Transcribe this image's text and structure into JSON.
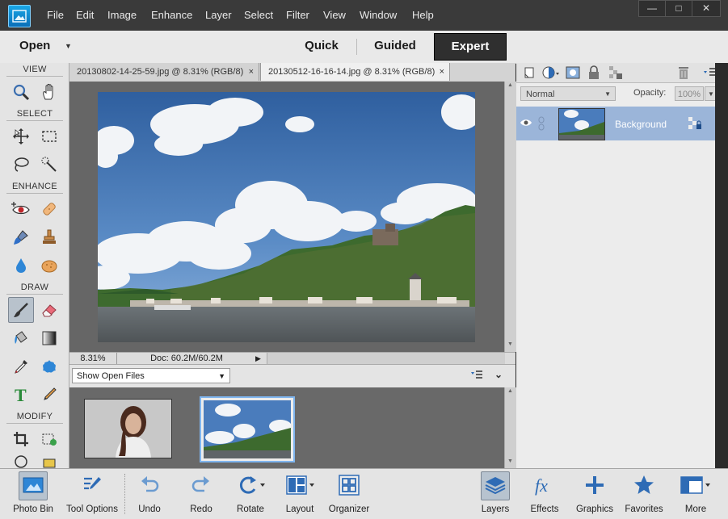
{
  "menubar": {
    "items": [
      "File",
      "Edit",
      "Image",
      "Enhance",
      "Layer",
      "Select",
      "Filter",
      "View",
      "Window",
      "Help"
    ]
  },
  "modebar": {
    "open_label": "Open",
    "tabs": [
      "Quick",
      "Guided",
      "Expert"
    ],
    "active_tab": "Expert"
  },
  "tools": {
    "groups": [
      "VIEW",
      "SELECT",
      "ENHANCE",
      "DRAW",
      "MODIFY"
    ]
  },
  "documents": {
    "tabs": [
      {
        "label": "20130802-14-25-59.jpg @ 8.31% (RGB/8)"
      },
      {
        "label": "20130512-16-16-14.jpg @ 8.31% (RGB/8)"
      }
    ],
    "close_glyph": "×"
  },
  "status": {
    "zoom": "8.31%",
    "doc_size": "Doc: 60.2M/60.2M"
  },
  "photo_bin": {
    "filter_value": "Show Open Files"
  },
  "layers": {
    "blend_mode": "Normal",
    "opacity_label": "Opacity:",
    "opacity_value": "100%",
    "items": [
      {
        "name": "Background"
      }
    ]
  },
  "bottombar": {
    "left": [
      "Photo Bin",
      "Tool Options",
      "Undo",
      "Redo",
      "Rotate",
      "Layout",
      "Organizer"
    ],
    "right": [
      "Layers",
      "Effects",
      "Graphics",
      "Favorites",
      "More"
    ]
  },
  "colors": {
    "accent_selected": "#9bb5d9",
    "icon_blue": "#1e7bc7",
    "menubar_bg": "#3a3a3a"
  }
}
